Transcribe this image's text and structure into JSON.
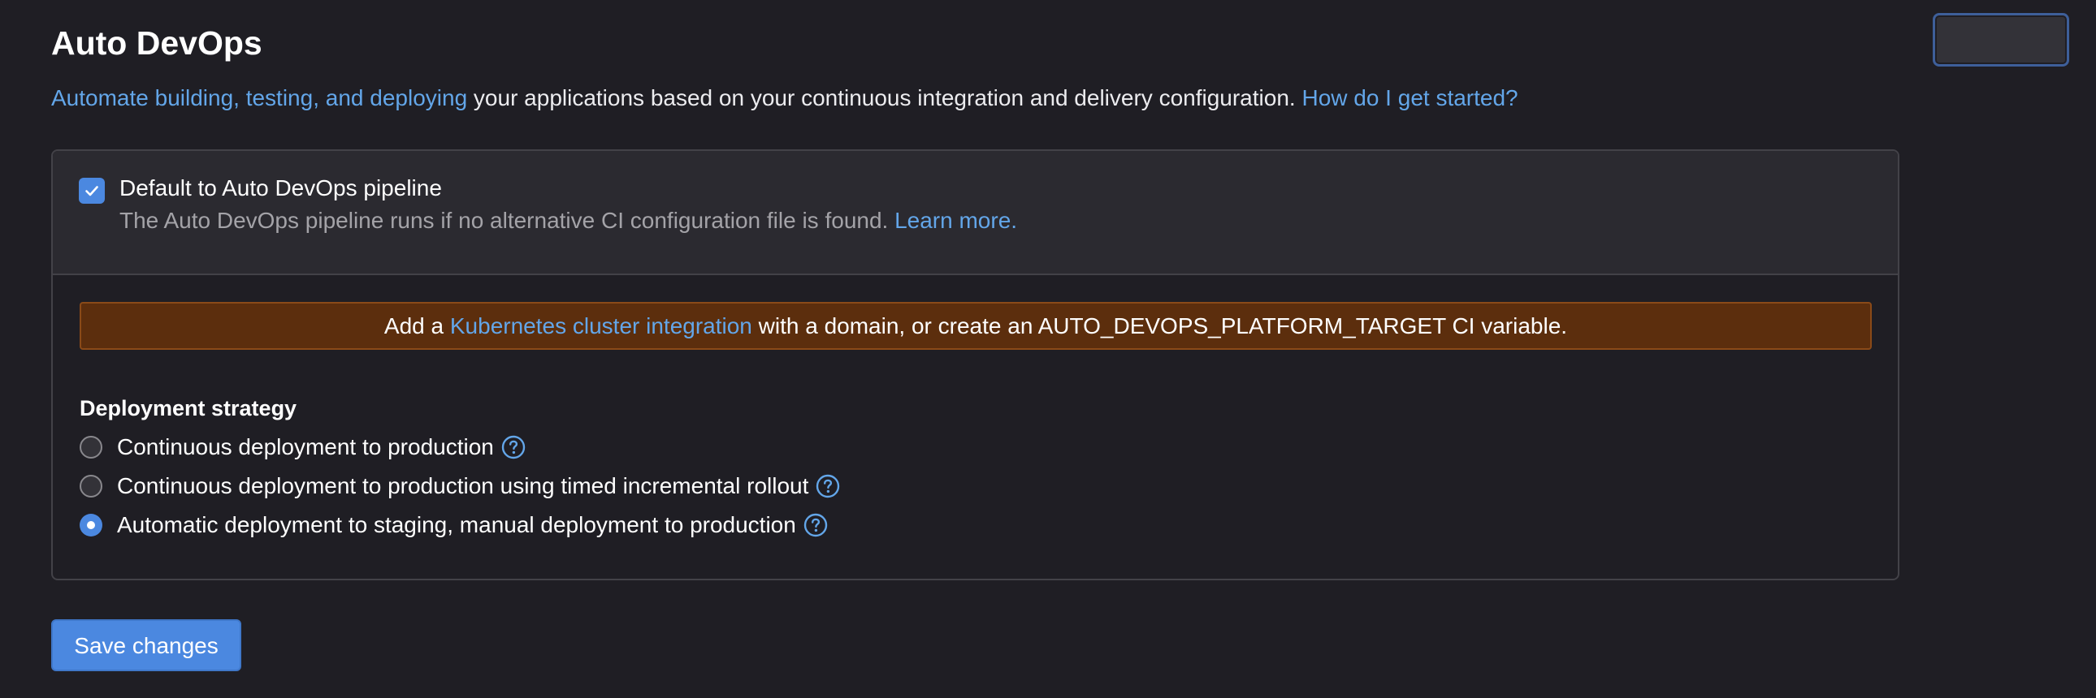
{
  "section": {
    "title": "Auto DevOps",
    "description_link": "Automate building, testing, and deploying",
    "description_text": " your applications based on your continuous integration and delivery configuration. ",
    "help_link": "How do I get started?"
  },
  "default_pipeline": {
    "label": "Default to Auto DevOps pipeline",
    "checked": true,
    "help_text": "The Auto DevOps pipeline runs if no alternative CI configuration file is found. ",
    "learn_more": "Learn more."
  },
  "alert": {
    "prefix": "Add a ",
    "link": "Kubernetes cluster integration",
    "suffix": " with a domain, or create an AUTO_DEVOPS_PLATFORM_TARGET CI variable."
  },
  "deployment_strategy": {
    "title": "Deployment strategy",
    "options": [
      {
        "label": "Continuous deployment to production",
        "selected": false
      },
      {
        "label": "Continuous deployment to production using timed incremental rollout",
        "selected": false
      },
      {
        "label": "Automatic deployment to staging, manual deployment to production",
        "selected": true
      }
    ]
  },
  "actions": {
    "save_label": "Save changes"
  },
  "icons": {
    "checkbox": "check-icon",
    "help": "question-circle-icon"
  },
  "colors": {
    "background": "#1f1e24",
    "accent": "#4b88e0",
    "link": "#63a6e9",
    "alert_background": "#5c2e0d"
  }
}
